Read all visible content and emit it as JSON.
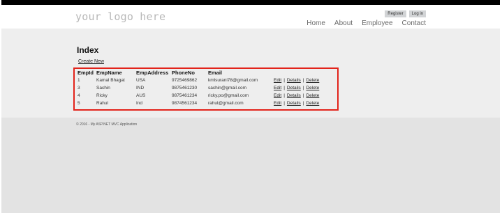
{
  "header": {
    "logo_text": "your logo here",
    "register_label": "Register",
    "login_label": "Log in",
    "nav": [
      "Home",
      "About",
      "Employee",
      "Contact"
    ]
  },
  "page": {
    "title": "Index",
    "create_link": "Create New"
  },
  "table": {
    "columns": [
      "EmpId",
      "EmpName",
      "EmpAddress",
      "PhoneNo",
      "Email"
    ],
    "rows": [
      [
        "1",
        "Kamal Bhagat",
        "USA",
        "9725469862",
        "kmlsurani78@gmail.com"
      ],
      [
        "3",
        "Sachin",
        "IND",
        "9875461230",
        "sachin@gmail.com"
      ],
      [
        "4",
        "Ricky",
        "AUS",
        "9875461234",
        "ricky.po@gmail.com"
      ],
      [
        "5",
        "Rahul",
        "Ind",
        "9874561234",
        "rahul@gmail.com"
      ]
    ],
    "actions": [
      "Edit",
      "Details",
      "Delete"
    ],
    "separator": "|"
  },
  "footer": {
    "text": "© 2016 - My ASP.NET MVC Application"
  }
}
